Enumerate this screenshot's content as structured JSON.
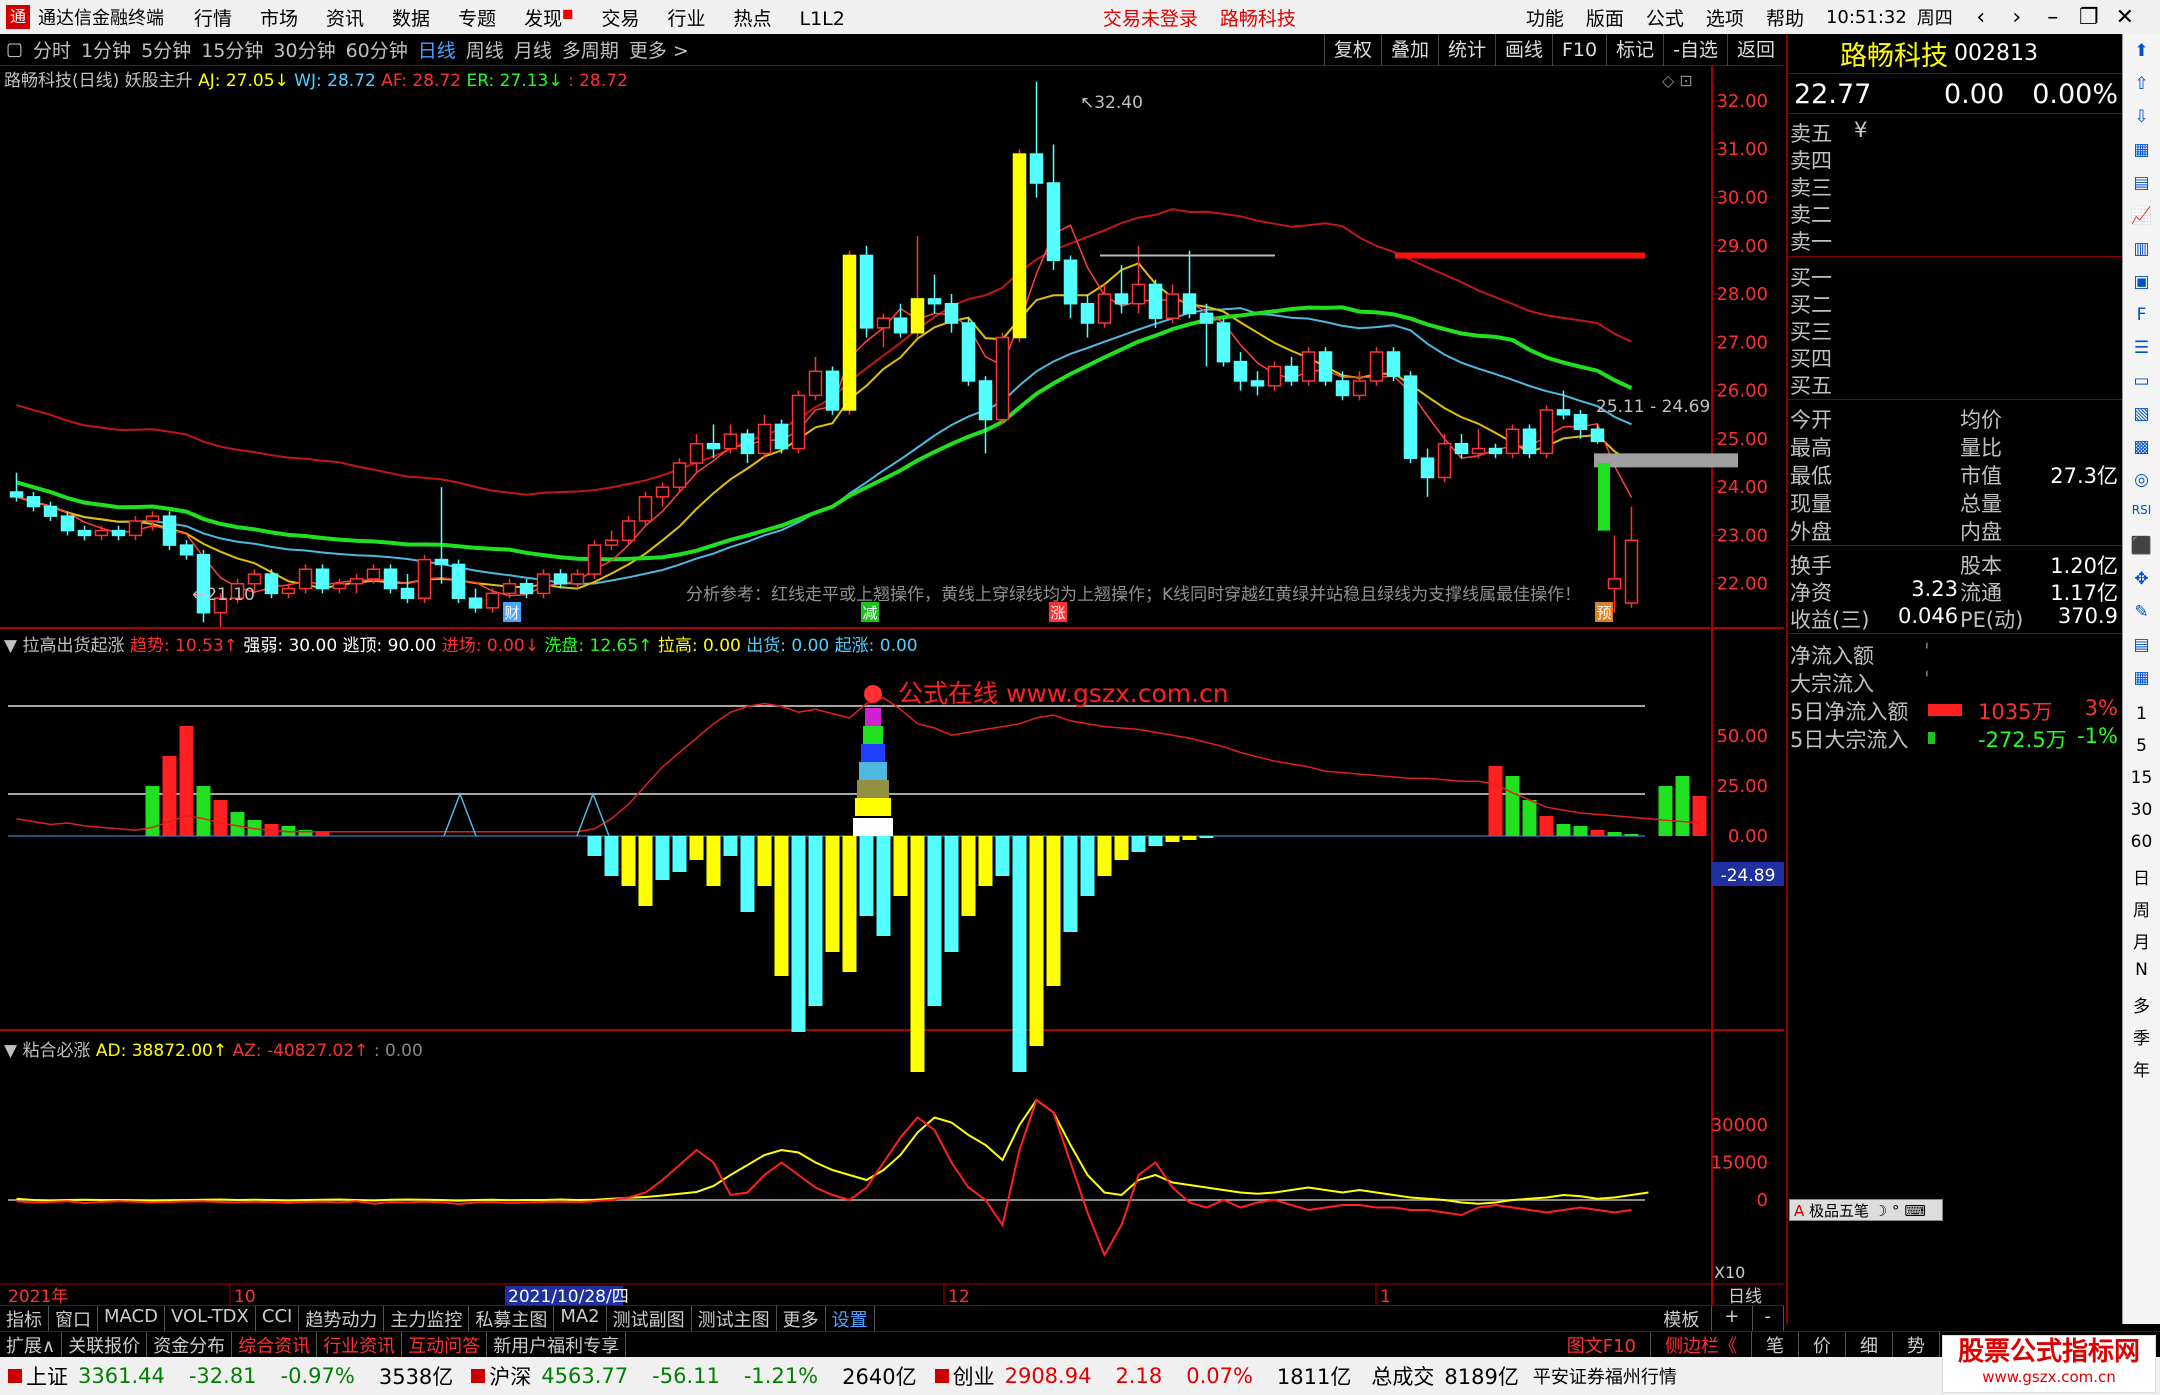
{
  "titlebar": {
    "logo": "通",
    "app_title": "通达信金融终端",
    "menu": [
      "行情",
      "市场",
      "资讯",
      "数据",
      "专题",
      "发现",
      "交易",
      "行业",
      "热点",
      "L1L2"
    ],
    "login": "交易未登录",
    "stock": "路畅科技",
    "rmenu": [
      "功能",
      "版面",
      "公式",
      "选项",
      "帮助"
    ],
    "time": "10:51:32",
    "weekday": "周四"
  },
  "periods": [
    "分时",
    "1分钟",
    "5分钟",
    "15分钟",
    "30分钟",
    "60分钟",
    "日线",
    "周线",
    "月线",
    "多周期",
    "更多 >"
  ],
  "active_period": "日线",
  "tools": [
    "复权",
    "叠加",
    "统计",
    "画线",
    "F10",
    "标记",
    "-自选",
    "返回"
  ],
  "main_legend": {
    "name": "路畅科技(日线)",
    "formula": "妖股主升",
    "aj": "AJ: 27.05↓",
    "wj": "WJ: 28.72",
    "af": "AF: 28.72",
    "er": "ER: 27.13↓",
    "v": ": 28.72"
  },
  "main_axis": [
    "32.00",
    "31.00",
    "30.00",
    "29.00",
    "28.00",
    "27.00",
    "26.00",
    "25.00",
    "24.00",
    "23.00",
    "22.00"
  ],
  "labels": {
    "high": "32.40",
    "low": "21.10",
    "range": "25.11 - 24.69",
    "note": "分析参考：红线走平或上翘操作，黄线上穿绿线均为上翘操作；K线同时穿越红黄绿并站稳且绿线为支撑线属最佳操作！",
    "m_cai": "财",
    "m_jian": "减",
    "m_zhang": "涨",
    "m_yu": "预",
    "watermark": "公式在线  www.gszx.com.cn",
    "ind_val": "-24.89",
    "x10": "X10"
  },
  "ind1_legend": {
    "name": "拉高出货起涨",
    "qs": "趋势: 10.53↑",
    "qr": "强弱: 30.00",
    "td": "逃顶: 90.00",
    "jc": "进场: 0.00↓",
    "xp": "洗盘: 12.65↑",
    "lg": "拉高: 0.00",
    "ch": "出货: 0.00",
    "qz": "起涨: 0.00"
  },
  "ind1_axis": [
    "50.00",
    "25.00",
    "0.00"
  ],
  "ind2_legend": {
    "name": "粘合必涨",
    "ad": "AD: 38872.00↑",
    "az": "AZ: -40827.02↑",
    "v": ": 0.00"
  },
  "ind2_axis": [
    "30000",
    "15000",
    "0"
  ],
  "time_axis": {
    "y": "2021年",
    "m10": "10",
    "cur": "2021/10/28/四",
    "m12": "12",
    "m1": "1",
    "period": "日线"
  },
  "right_panel": {
    "name": "路畅科技",
    "code": "002813",
    "price": "22.77",
    "change": "0.00",
    "pct": "0.00%",
    "asks": [
      "卖五",
      "卖四",
      "卖三",
      "卖二",
      "卖一"
    ],
    "bids": [
      "买一",
      "买二",
      "买三",
      "买四",
      "买五"
    ],
    "stats": [
      [
        "今开",
        "",
        "均价",
        ""
      ],
      [
        "最高",
        "",
        "量比",
        ""
      ],
      [
        "最低",
        "",
        "市值",
        "27.3亿"
      ],
      [
        "现量",
        "",
        "总量",
        ""
      ],
      [
        "外盘",
        "",
        "内盘",
        ""
      ]
    ],
    "stats2": [
      [
        "换手",
        "",
        "股本",
        "1.20亿"
      ],
      [
        "净资",
        "3.23",
        "流通",
        "1.17亿"
      ],
      [
        "收益(三)",
        "0.046",
        "PE(动)",
        "370.9"
      ]
    ],
    "flows": [
      {
        "label": "净流入额",
        "value": "",
        "pct": ""
      },
      {
        "label": "大宗流入",
        "value": "",
        "pct": ""
      },
      {
        "label": "5日净流入额",
        "value": "1035万",
        "pct": "3%"
      },
      {
        "label": "5日大宗流入",
        "value": "-272.5万",
        "pct": "-1%"
      }
    ],
    "plugin": "极品五笔"
  },
  "bottom_tabs": [
    "指标",
    "窗口",
    "MACD",
    "VOL-TDX",
    "CCI",
    "趋势动力",
    "主力监控",
    "私募主图",
    "MA2",
    "测试副图",
    "测试主图",
    "更多",
    "设置"
  ],
  "bottom_right": [
    "模板",
    "+",
    "-"
  ],
  "bottom_tabs2": [
    "扩展∧",
    "关联报价",
    "资金分布",
    "综合资讯",
    "行业资讯",
    "互动问答",
    "新用户福利专享"
  ],
  "bottom_tabs2_right": [
    "图文F10",
    "侧边栏《",
    "笔",
    "价",
    "细",
    "势"
  ],
  "status": [
    {
      "name": "上证",
      "v": "3361.44",
      "c": "-32.81",
      "p": "-0.97%",
      "a": "3538亿"
    },
    {
      "name": "沪深",
      "v": "4563.77",
      "c": "-56.11",
      "p": "-1.21%",
      "a": "2640亿"
    },
    {
      "name": "创业",
      "v": "2908.94",
      "c": "2.18",
      "p": "0.07%",
      "a": "1811亿"
    }
  ],
  "status_total": {
    "label": "总成交",
    "value": "8189亿"
  },
  "status_broker": "平安证券福州行情",
  "sidebar_periods": [
    "1",
    "5",
    "15",
    "30",
    "60",
    "日",
    "周",
    "月",
    "N",
    "多",
    "季",
    "年"
  ],
  "brand": {
    "cn": "股票公式指标网",
    "url": "www.gszx.com.cn"
  },
  "chart_data": {
    "type": "candlestick",
    "ylim": [
      21,
      32.6
    ],
    "ohlc": [
      [
        23.9,
        24.3,
        23.7,
        23.8
      ],
      [
        23.8,
        23.9,
        23.5,
        23.6
      ],
      [
        23.6,
        23.7,
        23.3,
        23.4
      ],
      [
        23.4,
        23.5,
        23,
        23.1
      ],
      [
        23.1,
        23.2,
        22.9,
        23
      ],
      [
        23,
        23.2,
        22.9,
        23.1
      ],
      [
        23.1,
        23.2,
        22.9,
        23
      ],
      [
        23,
        23.4,
        22.9,
        23.3
      ],
      [
        23.3,
        23.5,
        23.1,
        23.4
      ],
      [
        23.4,
        23.5,
        22.7,
        22.8
      ],
      [
        22.8,
        22.9,
        22.5,
        22.6
      ],
      [
        22.6,
        22.7,
        21.2,
        21.4
      ],
      [
        21.4,
        21.8,
        21.1,
        21.7
      ],
      [
        21.7,
        22.1,
        21.6,
        22
      ],
      [
        22,
        22.3,
        21.8,
        22.2
      ],
      [
        22.2,
        22.3,
        21.7,
        21.8
      ],
      [
        21.8,
        22,
        21.7,
        21.9
      ],
      [
        21.9,
        22.4,
        21.8,
        22.3
      ],
      [
        22.3,
        22.4,
        21.8,
        21.9
      ],
      [
        21.9,
        22.1,
        21.8,
        22
      ],
      [
        22,
        22.2,
        21.8,
        22.1
      ],
      [
        22.1,
        22.4,
        22,
        22.3
      ],
      [
        22.3,
        22.4,
        21.8,
        21.9
      ],
      [
        21.9,
        22.2,
        21.6,
        21.7
      ],
      [
        21.7,
        22.6,
        21.6,
        22.5
      ],
      [
        22.5,
        24,
        22,
        22.4
      ],
      [
        22.4,
        22.5,
        21.6,
        21.7
      ],
      [
        21.7,
        21.9,
        21.4,
        21.5
      ],
      [
        21.5,
        21.9,
        21.4,
        21.8
      ],
      [
        21.8,
        22.1,
        21.7,
        22
      ],
      [
        22,
        22.1,
        21.7,
        21.8
      ],
      [
        21.8,
        22.3,
        21.7,
        22.2
      ],
      [
        22.2,
        22.3,
        21.9,
        22
      ],
      [
        22,
        22.3,
        21.9,
        22.2
      ],
      [
        22.2,
        22.9,
        22.1,
        22.8
      ],
      [
        22.8,
        23.1,
        22.7,
        22.9
      ],
      [
        22.9,
        23.4,
        22.8,
        23.3
      ],
      [
        23.3,
        23.9,
        23.2,
        23.8
      ],
      [
        23.8,
        24.1,
        23.6,
        24
      ],
      [
        24,
        24.6,
        23.9,
        24.5
      ],
      [
        24.5,
        25.1,
        24.3,
        24.9
      ],
      [
        24.9,
        25.3,
        24.6,
        24.8
      ],
      [
        24.8,
        25.3,
        24.7,
        25.1
      ],
      [
        25.1,
        25.2,
        24.5,
        24.7
      ],
      [
        24.7,
        25.5,
        24.6,
        25.3
      ],
      [
        25.3,
        25.4,
        24.7,
        24.8
      ],
      [
        24.8,
        26,
        24.7,
        25.9
      ],
      [
        25.9,
        26.7,
        25.8,
        26.4
      ],
      [
        26.4,
        26.5,
        25.5,
        25.6
      ],
      [
        25.6,
        28.9,
        25.5,
        28.8
      ],
      [
        28.8,
        29,
        27.1,
        27.3
      ],
      [
        27.3,
        27.6,
        26.9,
        27.5
      ],
      [
        27.5,
        27.8,
        27.1,
        27.2
      ],
      [
        27.2,
        29.2,
        27.1,
        27.9
      ],
      [
        27.9,
        28.4,
        27.6,
        27.8
      ],
      [
        27.8,
        28,
        27.2,
        27.4
      ],
      [
        27.4,
        27.5,
        26.1,
        26.2
      ],
      [
        26.2,
        26.3,
        24.7,
        25.4
      ],
      [
        25.4,
        27.2,
        25.3,
        27.1
      ],
      [
        27.1,
        31,
        27,
        30.9
      ],
      [
        30.9,
        32.4,
        30,
        30.3
      ],
      [
        30.3,
        31.1,
        28.5,
        28.7
      ],
      [
        28.7,
        28.8,
        27.5,
        27.8
      ],
      [
        27.8,
        28,
        27.1,
        27.4
      ],
      [
        27.4,
        28.2,
        27.3,
        28
      ],
      [
        28,
        28.6,
        27.6,
        27.8
      ],
      [
        27.8,
        29,
        27.6,
        28.2
      ],
      [
        28.2,
        28.3,
        27.3,
        27.5
      ],
      [
        27.5,
        28.2,
        27.4,
        28
      ],
      [
        28,
        28.9,
        27.5,
        27.6
      ],
      [
        27.6,
        27.8,
        26.5,
        27.4
      ],
      [
        27.4,
        27.5,
        26.5,
        26.6
      ],
      [
        26.6,
        26.8,
        26,
        26.2
      ],
      [
        26.2,
        26.4,
        25.9,
        26.1
      ],
      [
        26.1,
        26.6,
        26,
        26.5
      ],
      [
        26.5,
        26.7,
        26.1,
        26.2
      ],
      [
        26.2,
        26.9,
        26.1,
        26.8
      ],
      [
        26.8,
        26.9,
        26.1,
        26.2
      ],
      [
        26.2,
        26.4,
        25.8,
        25.9
      ],
      [
        25.9,
        26.4,
        25.8,
        26.2
      ],
      [
        26.2,
        26.9,
        26.1,
        26.8
      ],
      [
        26.8,
        26.9,
        26.2,
        26.3
      ],
      [
        26.3,
        26.4,
        24.5,
        24.6
      ],
      [
        24.6,
        24.8,
        23.8,
        24.2
      ],
      [
        24.2,
        25.1,
        24.1,
        24.9
      ],
      [
        24.9,
        25.1,
        24.6,
        24.7
      ],
      [
        24.7,
        25.2,
        24.6,
        24.8
      ],
      [
        24.8,
        24.9,
        24.6,
        24.7
      ],
      [
        24.7,
        25.3,
        24.6,
        25.2
      ],
      [
        25.2,
        25.3,
        24.6,
        24.7
      ],
      [
        24.7,
        25.7,
        24.6,
        25.6
      ],
      [
        25.6,
        26,
        25.4,
        25.5
      ],
      [
        25.5,
        25.6,
        25,
        25.2
      ],
      [
        25.2,
        25.3,
        24.9,
        24.95
      ],
      [
        21.9,
        23,
        21.4,
        22.1
      ],
      [
        21.6,
        23.6,
        21.5,
        22.9
      ]
    ],
    "ind1_bars": [
      0,
      0,
      0,
      0,
      0,
      0,
      0,
      0,
      25,
      40,
      55,
      25,
      18,
      12,
      8,
      6,
      5,
      3,
      2,
      0,
      0,
      0,
      0,
      0,
      0,
      0,
      0,
      0,
      0,
      0,
      0,
      0,
      0,
      0,
      -10,
      -20,
      -25,
      -35,
      -22,
      -18,
      -12,
      -25,
      -10,
      -38,
      -25,
      -70,
      -98,
      -85,
      -58,
      -68,
      -40,
      -50,
      -30,
      -118,
      -85,
      -58,
      -40,
      -25,
      -20,
      -118,
      -105,
      -75,
      -48,
      -30,
      -20,
      -12,
      -8,
      -5,
      -3,
      -2,
      -1,
      0,
      0,
      0,
      0,
      0,
      0,
      0,
      0,
      0,
      0,
      0,
      0,
      0,
      0,
      0,
      0,
      35,
      30,
      18,
      10,
      6,
      5,
      3,
      2,
      1,
      0,
      25,
      30,
      20
    ],
    "ind1_line": [
      12,
      10,
      8,
      9,
      7,
      6,
      5,
      4,
      6,
      10,
      14,
      12,
      9,
      7,
      5,
      4,
      3,
      3,
      3,
      3,
      3,
      3,
      3,
      3,
      3,
      3,
      3,
      3,
      3,
      3,
      3,
      3,
      3,
      3,
      5,
      12,
      22,
      35,
      48,
      58,
      68,
      78,
      86,
      90,
      92,
      90,
      86,
      88,
      85,
      82,
      92,
      96,
      88,
      78,
      75,
      70,
      72,
      74,
      76,
      78,
      82,
      84,
      80,
      78,
      76,
      75,
      74,
      72,
      70,
      68,
      65,
      62,
      58,
      55,
      52,
      50,
      48,
      45,
      44,
      43,
      42,
      41,
      40,
      40,
      39,
      38,
      38,
      36,
      30,
      25,
      20,
      18,
      16,
      15,
      14,
      13,
      12,
      11,
      10,
      9
    ],
    "ind2_ad": [
      500,
      0,
      -200,
      0,
      100,
      0,
      0,
      -100,
      -200,
      -100,
      0,
      100,
      200,
      0,
      100,
      0,
      -200,
      0,
      100,
      200,
      0,
      -200,
      100,
      200,
      100,
      0,
      -300,
      0,
      100,
      -100,
      0,
      0,
      200,
      0,
      100,
      500,
      900,
      1200,
      1800,
      2500,
      3200,
      5600,
      10000,
      14000,
      18000,
      20000,
      19000,
      15000,
      12000,
      10000,
      8000,
      12000,
      18000,
      27000,
      33000,
      31000,
      26000,
      22000,
      16000,
      30000,
      40000,
      35000,
      22000,
      10000,
      3000,
      2000,
      8000,
      10000,
      7000,
      6000,
      5000,
      4000,
      3000,
      2500,
      3000,
      4000,
      5000,
      4000,
      3000,
      4000,
      3000,
      2000,
      1000,
      500,
      0,
      -1000,
      -1500,
      -1000,
      0,
      500,
      1000,
      2000,
      1500,
      500,
      1000,
      2000,
      3000
    ],
    "ind2_az": [
      -500,
      -1000,
      -800,
      -500,
      -1200,
      -800,
      -500,
      -700,
      -1000,
      -800,
      -600,
      -500,
      -800,
      -1000,
      -700,
      -900,
      -1200,
      -800,
      -700,
      -1000,
      -500,
      -1500,
      -800,
      -1000,
      -700,
      -900,
      -1600,
      -1000,
      -800,
      -1200,
      -1000,
      -800,
      -700,
      -900,
      -500,
      0,
      1000,
      3000,
      8000,
      14000,
      20000,
      15000,
      2000,
      3000,
      10000,
      15000,
      10000,
      5000,
      2000,
      0,
      5000,
      15000,
      25000,
      33000,
      28000,
      15000,
      5000,
      0,
      -10000,
      20000,
      40000,
      35000,
      15000,
      -5000,
      -22000,
      -10000,
      10000,
      15000,
      5000,
      -1000,
      -3000,
      0,
      -3000,
      -1000,
      0,
      -2000,
      -4000,
      -3000,
      -2000,
      -2000,
      -3000,
      -3000,
      -4000,
      -4000,
      -5000,
      -6000,
      -3000,
      -2000,
      -3000,
      -4000,
      -5000,
      -4000,
      -3000,
      -4000,
      -5000,
      -4000
    ]
  }
}
